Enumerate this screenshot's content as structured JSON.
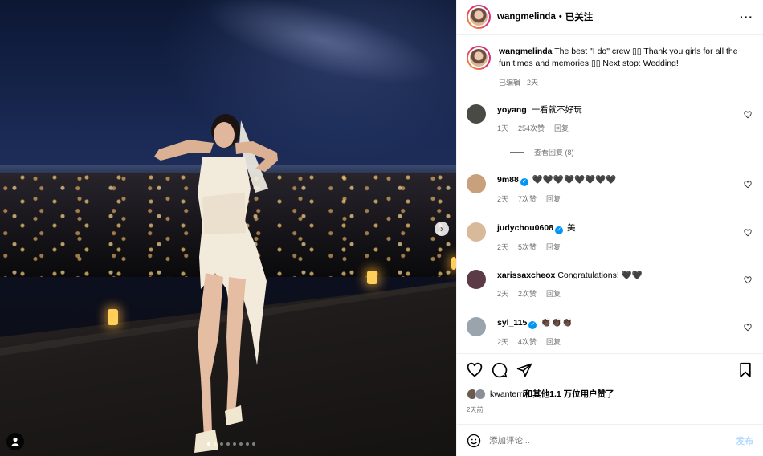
{
  "header": {
    "username": "wangmelinda",
    "separator": "•",
    "follow_status": "已关注",
    "more": "···"
  },
  "caption": {
    "username": "wangmelinda",
    "text": "The best \"I do\" crew ▯▯ Thank you girls for all the fun times and memories ▯▯ Next stop: Wedding!",
    "edited": "已编辑 · 2天"
  },
  "comments": [
    {
      "username": "yoyang",
      "verified": false,
      "text": "一看就不好玩",
      "time": "1天",
      "likes": "254次赞",
      "reply": "回复",
      "avatar_color": "#4a4a44"
    },
    {
      "username": "9m88",
      "verified": true,
      "text": "🖤🖤🖤🖤🖤🖤🖤🖤",
      "time": "2天",
      "likes": "7次赞",
      "reply": "回复",
      "avatar_color": "#c9a07c"
    },
    {
      "username": "judychou0608",
      "verified": true,
      "text": "美",
      "time": "2天",
      "likes": "5次赞",
      "reply": "回复",
      "avatar_color": "#d8b99a"
    },
    {
      "username": "xarissaxcheox",
      "verified": false,
      "text": "Congratulations! 🖤🖤",
      "time": "2天",
      "likes": "2次赞",
      "reply": "回复",
      "avatar_color": "#5a3b46"
    },
    {
      "username": "syl_115",
      "verified": true,
      "text": "👏🏿👏🏿👏🏿",
      "time": "2天",
      "likes": "4次赞",
      "reply": "回复",
      "avatar_color": "#9aa4ad"
    }
  ],
  "view_replies": "查看回复 (8)",
  "likes_line": {
    "user": "kwanterri",
    "rest": "和其他1.1 万位用户赞了"
  },
  "post_time": "2天前",
  "add_comment": {
    "placeholder": "添加评论...",
    "post_label": "发布"
  },
  "photo": {
    "carousel_next": "›",
    "dots": 8,
    "active_dot": 0
  },
  "colors": {
    "accent": "#0095f6",
    "post_button_disabled": "#b3dbff",
    "muted": "#737373"
  }
}
